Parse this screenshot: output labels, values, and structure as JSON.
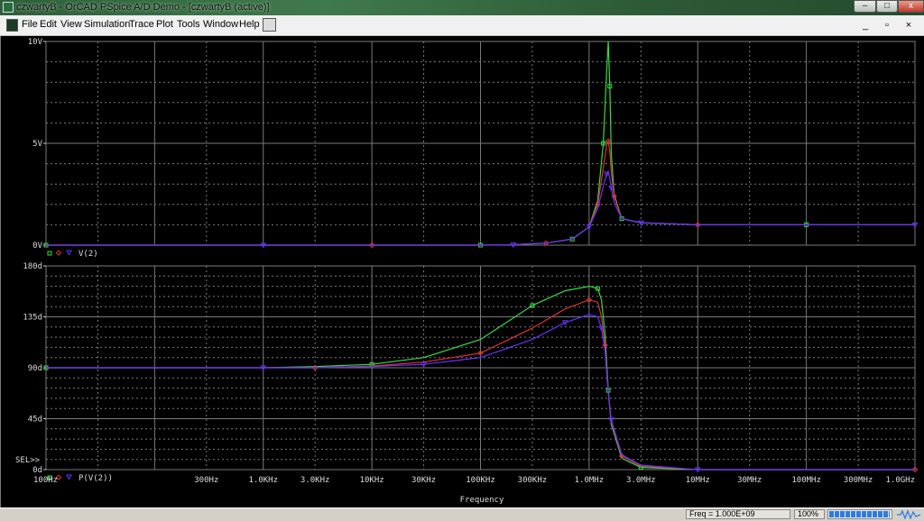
{
  "window": {
    "title": "czwartyB - OrCAD PSpice A/D Demo  - [czwartyB (active)]"
  },
  "menu": [
    "File",
    "Edit",
    "View",
    "Simulation",
    "Trace",
    "Plot",
    "Tools",
    "Window",
    "Help"
  ],
  "mdi": {
    "minimize": "_",
    "restore": "▫",
    "close": "×"
  },
  "colors": {
    "green": "#33dd44",
    "red": "#dd3333",
    "blue": "#6633ff",
    "grid": "#7a7a7a"
  },
  "chart_data": [
    {
      "type": "line",
      "xscale": "log",
      "xlim": [
        10,
        1000000000
      ],
      "ylim": [
        0,
        10
      ],
      "y_ticks": [
        "10V",
        "5V",
        "0V"
      ],
      "legend": "V(2)",
      "grid": true,
      "series": [
        {
          "color": "green",
          "x": [
            10,
            1000,
            10000,
            100000,
            200000,
            400000,
            700000,
            1000000,
            1200000,
            1350000,
            1450000,
            1500000,
            1550000,
            1600000,
            1700000,
            2000000,
            3000000,
            10000000,
            100000000,
            1000000000
          ],
          "values": [
            0,
            0,
            0,
            0,
            0.02,
            0.1,
            0.3,
            0.9,
            2.2,
            5,
            8.5,
            10,
            7.8,
            4.5,
            2.5,
            1.3,
            1.1,
            1.0,
            1.0,
            1.0
          ]
        },
        {
          "color": "red",
          "x": [
            10,
            1000,
            10000,
            100000,
            200000,
            400000,
            700000,
            1000000,
            1200000,
            1350000,
            1450000,
            1500000,
            1550000,
            1600000,
            1700000,
            2000000,
            3000000,
            10000000,
            100000000,
            1000000000
          ],
          "values": [
            0,
            0,
            0,
            0,
            0.02,
            0.1,
            0.3,
            0.9,
            2.0,
            3.8,
            4.9,
            5.1,
            4.6,
            3.6,
            2.4,
            1.3,
            1.1,
            1.0,
            1.0,
            1.0
          ]
        },
        {
          "color": "blue",
          "x": [
            10,
            1000,
            10000,
            100000,
            200000,
            400000,
            700000,
            1000000,
            1200000,
            1350000,
            1450000,
            1500000,
            1550000,
            1600000,
            1700000,
            2000000,
            3000000,
            10000000,
            100000000,
            1000000000
          ],
          "values": [
            0,
            0,
            0,
            0,
            0.02,
            0.1,
            0.3,
            0.9,
            1.8,
            2.9,
            3.5,
            3.6,
            3.3,
            2.8,
            2.1,
            1.3,
            1.1,
            1.0,
            1.0,
            1.0
          ]
        }
      ]
    },
    {
      "type": "line",
      "xscale": "log",
      "xlim": [
        10,
        1000000000
      ],
      "ylim": [
        0,
        180
      ],
      "y_ticks": [
        "180d",
        "135d",
        "90d",
        "45d",
        "0d"
      ],
      "sel_marker": "SEL>>",
      "legend": "P(V(2))",
      "xlabel": "Frequency",
      "x_ticks": [
        "100Hz",
        "300Hz",
        "1.0KHz",
        "3.0KHz",
        "10KHz",
        "30KHz",
        "100KHz",
        "300KHz",
        "1.0MHz",
        "3.0MHz",
        "10MHz",
        "30MHz",
        "100MHz",
        "300MHz",
        "1.0GHz"
      ],
      "grid": true,
      "series": [
        {
          "color": "green",
          "x": [
            10,
            1000,
            3000,
            10000,
            30000,
            100000,
            300000,
            600000,
            1000000,
            1200000,
            1300000,
            1400000,
            1500000,
            1600000,
            2000000,
            3000000,
            10000000,
            1000000000
          ],
          "values": [
            90,
            90,
            91,
            93,
            99,
            115,
            145,
            158,
            162,
            160,
            150,
            120,
            70,
            40,
            10,
            2,
            0,
            0
          ]
        },
        {
          "color": "red",
          "x": [
            10,
            1000,
            3000,
            10000,
            30000,
            100000,
            300000,
            600000,
            1000000,
            1200000,
            1300000,
            1400000,
            1500000,
            1600000,
            2000000,
            3000000,
            10000000,
            1000000000
          ],
          "values": [
            90,
            90,
            90,
            91.5,
            95,
            103,
            125,
            142,
            150,
            148,
            135,
            110,
            68,
            42,
            12,
            3,
            0,
            0
          ]
        },
        {
          "color": "blue",
          "x": [
            10,
            1000,
            3000,
            10000,
            30000,
            100000,
            300000,
            600000,
            1000000,
            1200000,
            1300000,
            1400000,
            1500000,
            1600000,
            2000000,
            3000000,
            10000000,
            1000000000
          ],
          "values": [
            90,
            90,
            90,
            91,
            93,
            99,
            115,
            130,
            137,
            135,
            125,
            105,
            67,
            44,
            13,
            4,
            0,
            0
          ]
        }
      ]
    }
  ],
  "status": {
    "freq": "Freq = 1.000E+09",
    "zoom": "100%",
    "progress": 0.95
  }
}
